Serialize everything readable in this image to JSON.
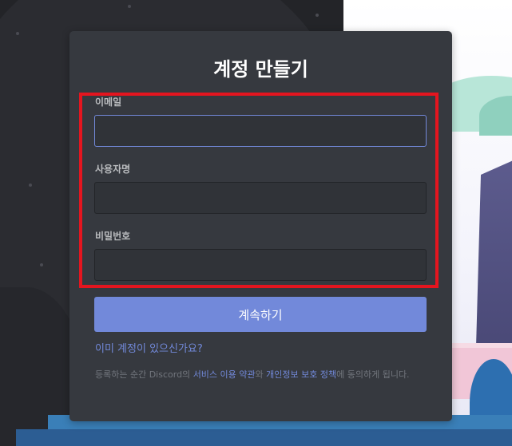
{
  "modal": {
    "title": "계정 만들기",
    "fields": {
      "email": {
        "label": "이메일",
        "value": "",
        "placeholder": ""
      },
      "username": {
        "label": "사용자명",
        "value": "",
        "placeholder": ""
      },
      "password": {
        "label": "비밀번호",
        "value": "",
        "placeholder": ""
      }
    },
    "continue_label": "계속하기",
    "login_link": "이미 계정이 있으신가요?",
    "terms": {
      "prefix": "등록하는 순간 Discord의 ",
      "tos_link": "서비스 이용 약관",
      "middle": "와 ",
      "privacy_link": "개인정보 보호 정책",
      "suffix": "에 동의하게 됩니다."
    }
  },
  "colors": {
    "modal_bg": "#36393f",
    "input_bg": "#303338",
    "accent": "#7289da",
    "highlight_border": "#e4151f",
    "label": "#b9bbbe",
    "muted_text": "#72767d"
  }
}
